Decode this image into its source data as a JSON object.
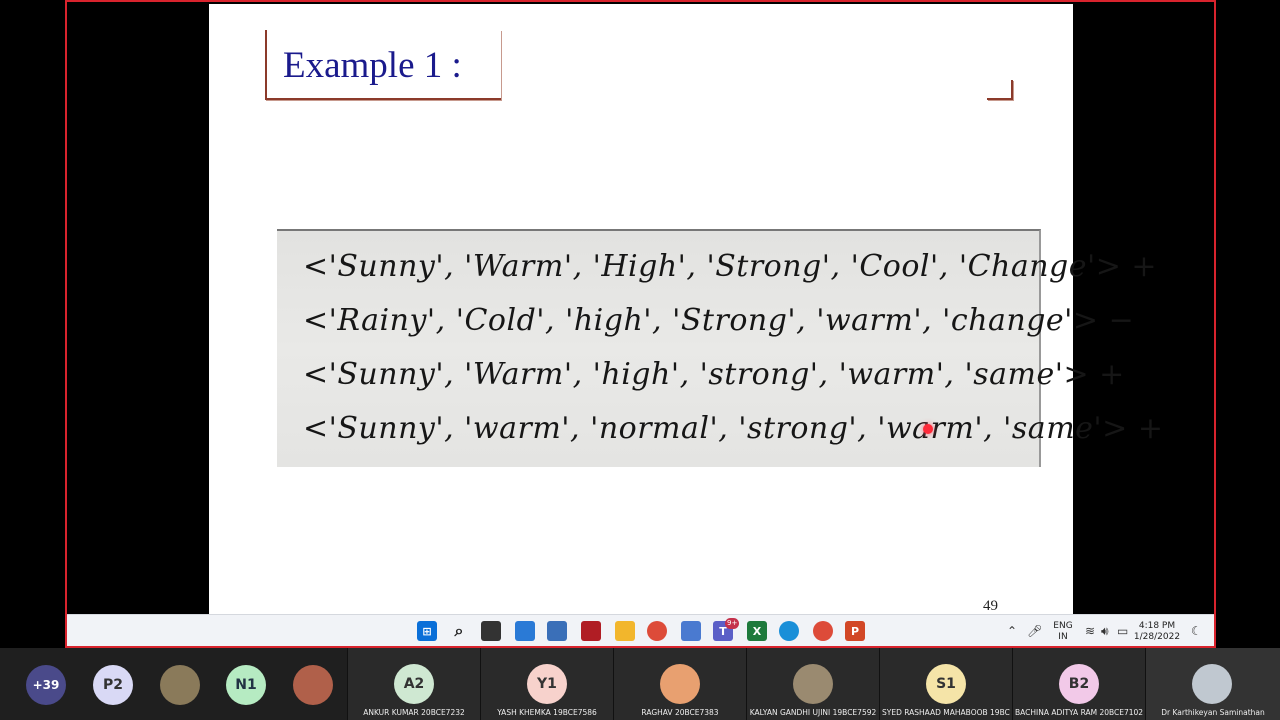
{
  "slide": {
    "title": "Example 1 :",
    "page_number": "49",
    "handwritten_lines": [
      "<'Sunny', 'Warm', 'High', 'Strong', 'Cool', 'Change'> +",
      "<'Rainy', 'Cold', 'high', 'Strong', 'warm', 'change'> −",
      "<'Sunny', 'Warm', 'high', 'strong', 'warm', 'same'> +",
      "<'Sunny', 'warm', 'normal', 'strong', 'warm', 'same'> +"
    ]
  },
  "taskbar": {
    "icons": [
      "windows-icon",
      "search-icon",
      "task-view-icon",
      "widgets-icon",
      "store-icon",
      "media-icon",
      "file-explorer-icon",
      "chrome-icon",
      "notepad-icon",
      "teams-icon",
      "excel-icon",
      "edge-icon",
      "chrome-alt-icon",
      "powerpoint-icon"
    ],
    "teams_badge": "9+",
    "language": "ENG",
    "region": "IN",
    "time": "4:18 PM",
    "date": "1/28/2022"
  },
  "participants": {
    "overflow_count": "+39",
    "bubbles": [
      {
        "initials": "P2",
        "color": "#d9d9f5"
      },
      {
        "initials": "",
        "color": "#8a7a5a"
      },
      {
        "initials": "N1",
        "color": "#b6ebc2"
      },
      {
        "initials": "",
        "color": "#b0604a"
      }
    ],
    "tiles": [
      {
        "initials": "A2",
        "name": "ANKUR KUMAR  20BCE7232",
        "color": "#cfe8d2"
      },
      {
        "initials": "Y1",
        "name": "YASH KHEMKA 19BCE7586",
        "color": "#f7d2cc"
      },
      {
        "initials": "",
        "name": "RAGHAV  20BCE7383",
        "color": "#e8a070"
      },
      {
        "initials": "",
        "name": "KALYAN GANDHI UJINI 19BCE7592",
        "color": "#9a8a70"
      },
      {
        "initials": "S1",
        "name": "SYED RASHAAD MAHABOOB 19BC...",
        "color": "#f5e4a8"
      },
      {
        "initials": "B2",
        "name": "BACHINA ADITYA RAM  20BCE7102",
        "color": "#f2c9e8"
      },
      {
        "initials": "",
        "name": "Dr Karthikeyan Saminathan",
        "color": "#c0c8d0"
      }
    ]
  }
}
